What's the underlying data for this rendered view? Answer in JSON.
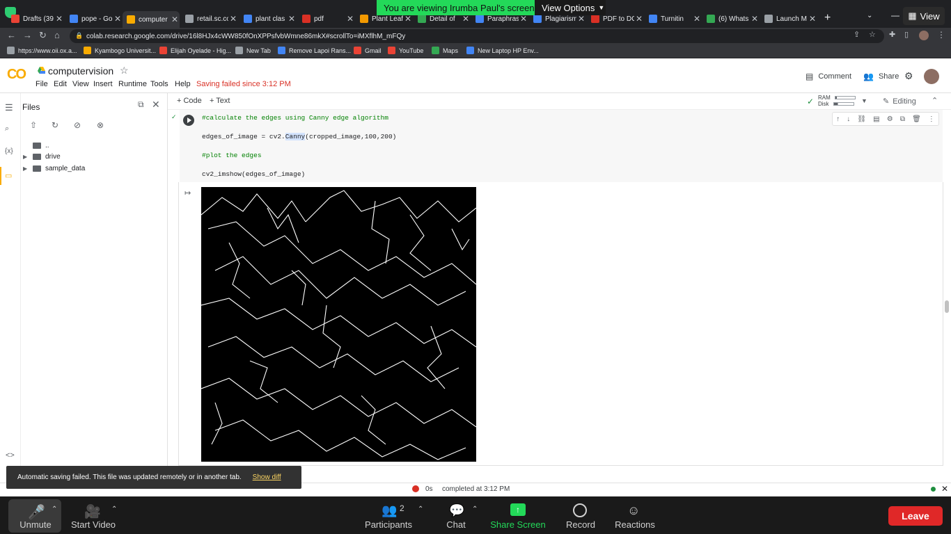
{
  "zoom": {
    "share_banner": "You are viewing Irumba Paul's screen",
    "view_options": "View Options",
    "view_label": "View",
    "unmute": "Unmute",
    "start_video": "Start Video",
    "participants": "Participants",
    "participants_count": "2",
    "chat": "Chat",
    "share_screen": "Share Screen",
    "record": "Record",
    "reactions": "Reactions",
    "leave": "Leave"
  },
  "browser": {
    "tabs": [
      {
        "title": "Drafts (39",
        "color": "#ea4335"
      },
      {
        "title": "pope - Go",
        "color": "#4285f4"
      },
      {
        "title": "computer",
        "color": "#f9ab00",
        "active": true
      },
      {
        "title": "retail.sc.co",
        "color": "#9aa0a6"
      },
      {
        "title": "plant clas",
        "color": "#4285f4"
      },
      {
        "title": "pdf",
        "color": "#d93025"
      },
      {
        "title": "Plant Leaf",
        "color": "#f29900"
      },
      {
        "title": "Detail of",
        "color": "#34a853"
      },
      {
        "title": "Paraphras",
        "color": "#4285f4"
      },
      {
        "title": "Plagiarism",
        "color": "#4285f4"
      },
      {
        "title": "PDF to DC",
        "color": "#d93025"
      },
      {
        "title": "Turnitin",
        "color": "#4285f4"
      },
      {
        "title": "(6) Whats",
        "color": "#34a853"
      },
      {
        "title": "Launch M",
        "color": "#9aa0a6"
      }
    ],
    "url": "colab.research.google.com/drive/16l8HJx4cWW850fOnXPPsfvbWmne86mkX#scrollTo=iMXflhM_mFQy",
    "bookmarks": [
      {
        "label": "https://www.oii.ox.a...",
        "color": "#9aa0a6"
      },
      {
        "label": "Kyambogo Universit...",
        "color": "#f9ab00"
      },
      {
        "label": "Elijah Oyelade - Hig...",
        "color": "#ea4335"
      },
      {
        "label": "New Tab",
        "color": "#9aa0a6"
      },
      {
        "label": "Remove Lapoi Rans...",
        "color": "#4285f4"
      },
      {
        "label": "Gmail",
        "color": "#ea4335"
      },
      {
        "label": "YouTube",
        "color": "#ea4335"
      },
      {
        "label": "Maps",
        "color": "#34a853"
      },
      {
        "label": "New Laptop HP Env...",
        "color": "#4285f4"
      }
    ]
  },
  "colab": {
    "logo": "CO",
    "title": "computervision",
    "menu": [
      "File",
      "Edit",
      "View",
      "Insert",
      "Runtime",
      "Tools",
      "Help"
    ],
    "save_status": "Saving failed since 3:12 PM",
    "comment": "Comment",
    "share": "Share",
    "add_code": "+ Code",
    "add_text": "+ Text",
    "ram": "RAM",
    "disk": "Disk",
    "editing": "Editing"
  },
  "files": {
    "title": "Files",
    "parent": "..",
    "items": [
      "drive",
      "sample_data"
    ]
  },
  "cell": {
    "lines": [
      "#calculate the edges using Canny edge algorithm",
      "edges_of_image = cv2.Canny(cropped_image,100,200)",
      "#plot the edges",
      "cv2_imshow(edges_of_image)"
    ]
  },
  "status": {
    "elapsed": "0s",
    "completed": "completed at 3:12 PM"
  },
  "toast": {
    "message": "Automatic saving failed. This file was updated remotely or in another tab.",
    "action": "Show diff"
  }
}
